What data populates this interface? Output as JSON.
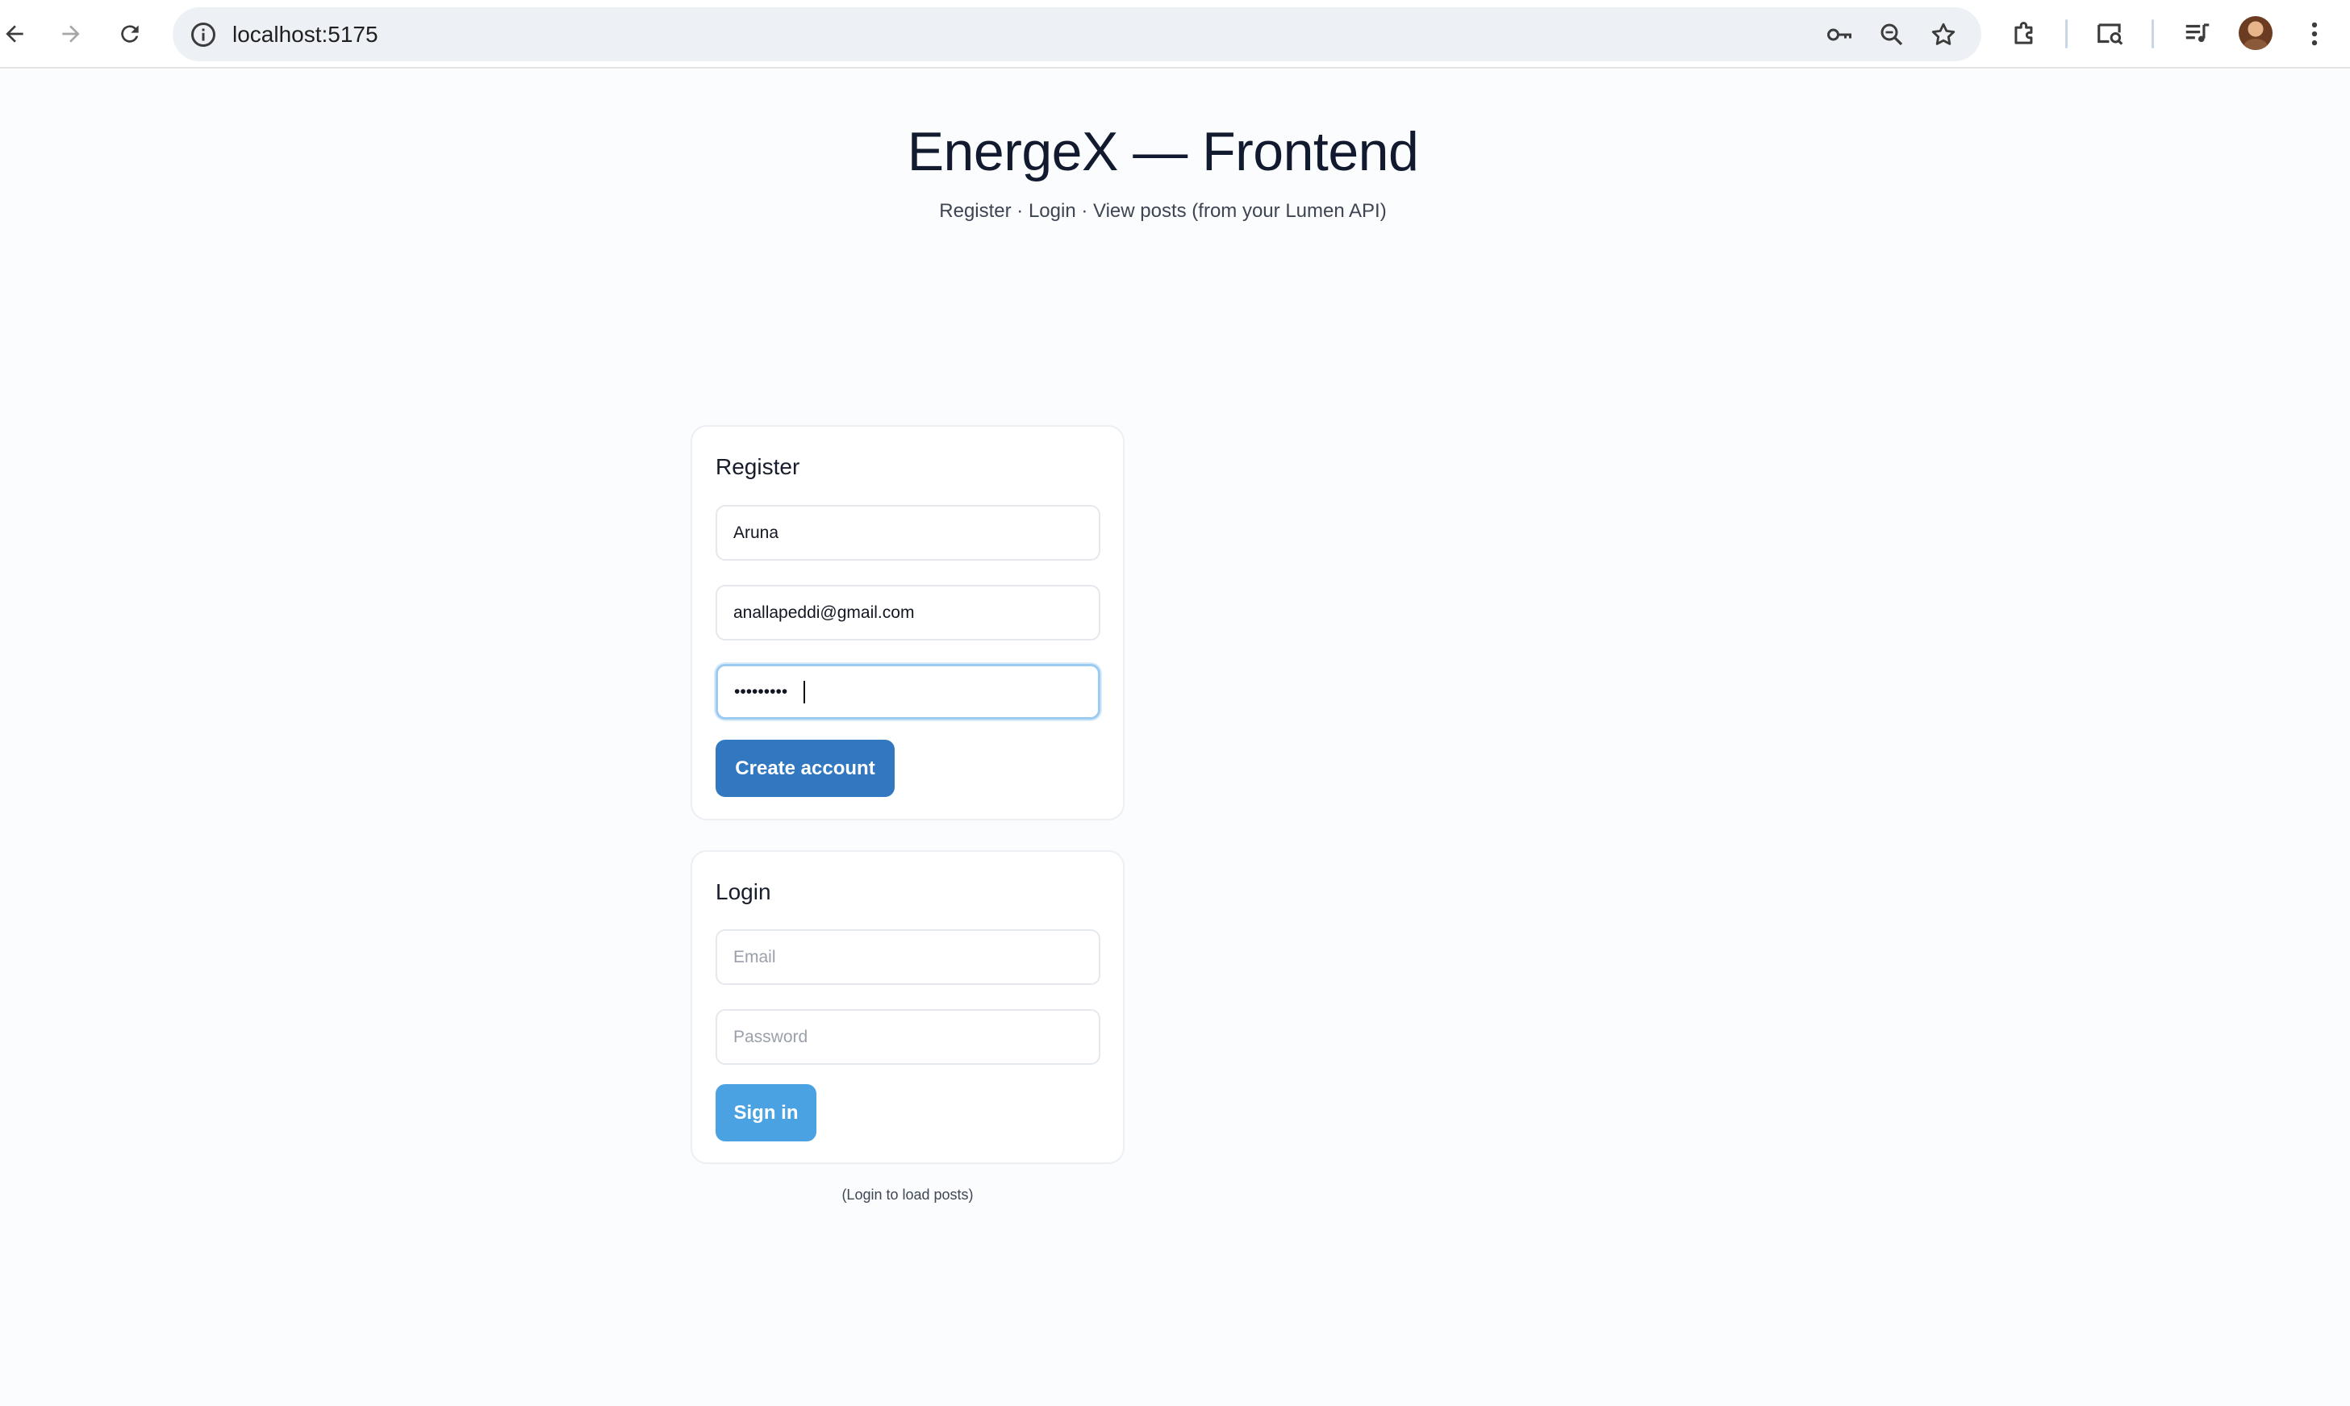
{
  "browser": {
    "url": "localhost:5175",
    "icons": [
      "back-icon",
      "forward-icon",
      "reload-icon",
      "site-info-icon",
      "password-key-icon",
      "zoom-icon",
      "bookmark-star-icon",
      "extensions-icon",
      "tab-search-icon",
      "media-controls-icon",
      "profile-avatar",
      "kebab-menu-icon"
    ]
  },
  "page": {
    "title": "EnergeX — Frontend",
    "subtitle": "Register · Login · View posts (from your Lumen API)"
  },
  "register": {
    "heading": "Register",
    "name_value": "Aruna",
    "email_value": "anallapeddi@gmail.com",
    "password_value": "•••••••••",
    "submit_label": "Create account"
  },
  "login": {
    "heading": "Login",
    "email_placeholder": "Email",
    "password_placeholder": "Password",
    "submit_label": "Sign in"
  },
  "posts": {
    "status_text": "(Login to load posts)"
  },
  "colors": {
    "primary_button": "#3178c0",
    "secondary_button": "#4ba2e3",
    "focus_ring": "#9ccbf2",
    "omnibox_bg": "#edf1f6"
  }
}
